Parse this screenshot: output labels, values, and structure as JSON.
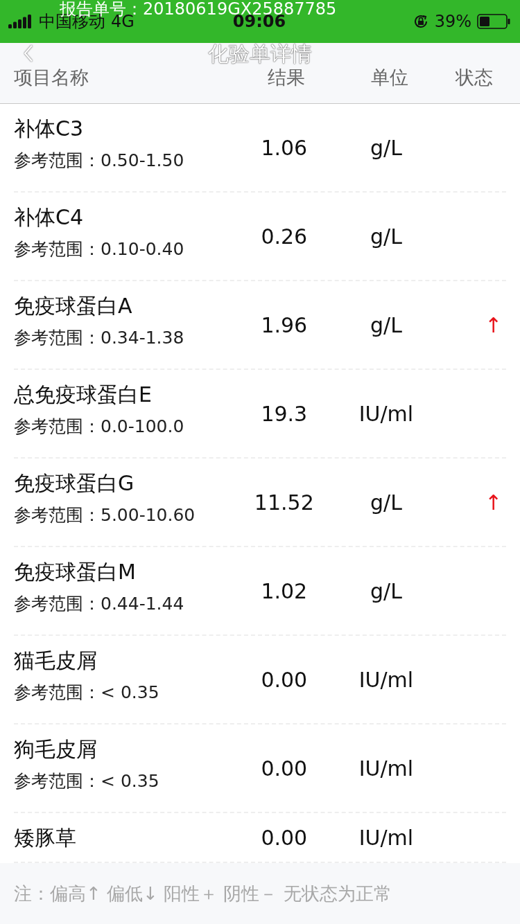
{
  "status_bar": {
    "carrier": "中国移动",
    "network": "4G",
    "time": "09:06",
    "battery_text": "39%"
  },
  "overlay_report_number": "报告单号：20180619GX25887785",
  "nav": {
    "title": "化验单详情"
  },
  "columns": [
    "项目名称",
    "结果",
    "单位",
    "状态"
  ],
  "rows": [
    {
      "name": "补体C3",
      "range": "参考范围：0.50-1.50",
      "result": "1.06",
      "unit": "g/L"
    },
    {
      "name": "补体C4",
      "range": "参考范围：0.10-0.40",
      "result": "0.26",
      "unit": "g/L"
    },
    {
      "name": "免疫球蛋白A",
      "range": "参考范围：0.34-1.38",
      "result": "1.96",
      "unit": "g/L",
      "status": "↑"
    },
    {
      "name": "总免疫球蛋白E",
      "range": "参考范围：0.0-100.0",
      "result": "19.3",
      "unit": "IU/ml"
    },
    {
      "name": "免疫球蛋白G",
      "range": "参考范围：5.00-10.60",
      "result": "11.52",
      "unit": "g/L",
      "status": "↑"
    },
    {
      "name": "免疫球蛋白M",
      "range": "参考范围：0.44-1.44",
      "result": "1.02",
      "unit": "g/L"
    },
    {
      "name": "猫毛皮屑",
      "range": "参考范围：< 0.35",
      "result": "0.00",
      "unit": "IU/ml"
    },
    {
      "name": "狗毛皮屑",
      "range": "参考范围：< 0.35",
      "result": "0.00",
      "unit": "IU/ml"
    },
    {
      "name": "矮豚草",
      "result": "0.00",
      "unit": "IU/ml"
    }
  ],
  "footer_note": "注：偏高↑ 偏低↓ 阳性＋ 阴性－ 无状态为正常"
}
